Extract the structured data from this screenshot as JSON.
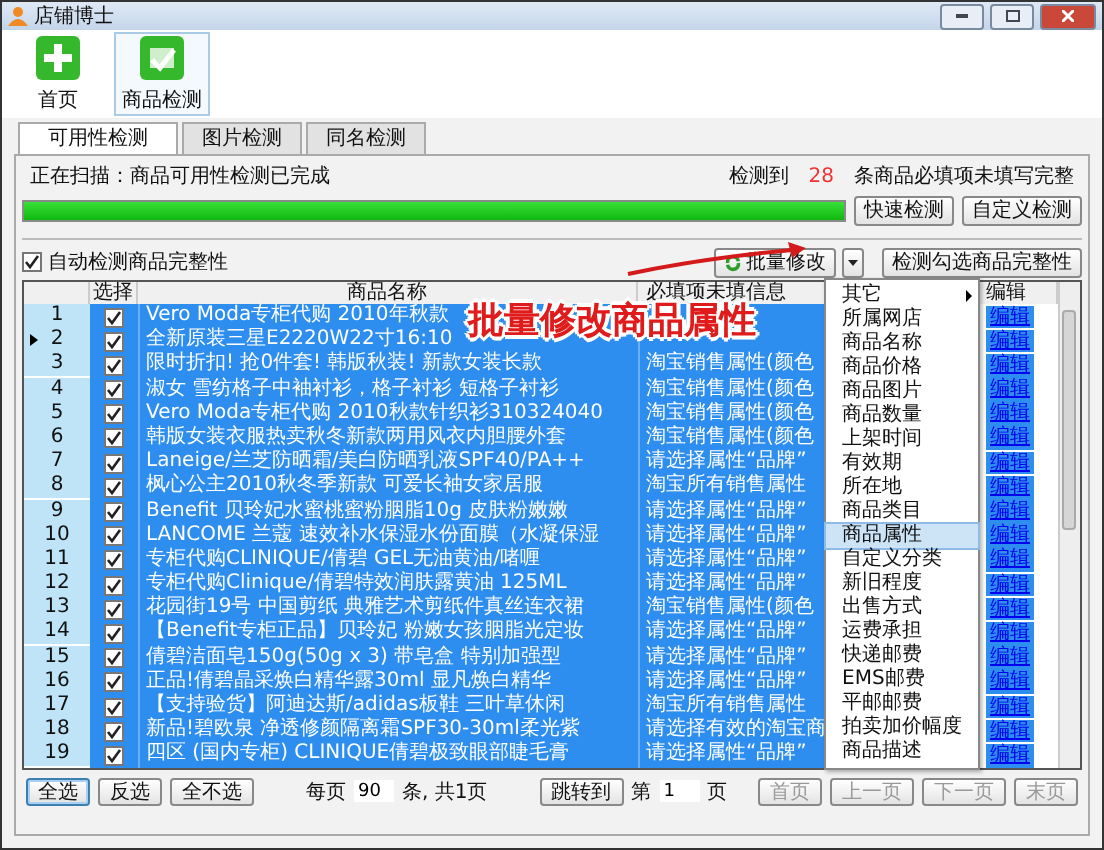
{
  "window": {
    "title": "店铺博士"
  },
  "toolbar": [
    {
      "label": "首页",
      "selected": false
    },
    {
      "label": "商品检测",
      "selected": true
    }
  ],
  "tabs": [
    {
      "label": "可用性检测",
      "selected": true
    },
    {
      "label": "图片检测",
      "selected": false
    },
    {
      "label": "同名检测",
      "selected": false
    }
  ],
  "scan_status": "正在扫描：商品可用性检测已完成",
  "summary": {
    "prefix": "检测到",
    "count": "28",
    "suffix": "条商品必填项未填写完整"
  },
  "progress": {
    "level": 1
  },
  "check_buttons": [
    "快速检测",
    "自定义检测"
  ],
  "auto_check": {
    "label": "自动检测商品完整性",
    "checked": true
  },
  "batch_button": "批量修改",
  "check_selected_button": "检测勾选商品完整性",
  "annotation": "批量修改商品属性",
  "table": {
    "columns": [
      "选择",
      "商品名称",
      "必填项未填信息",
      "编辑"
    ],
    "rows": [
      {
        "no": "1",
        "current": false,
        "checked": true,
        "selected": true,
        "name": "Vero Moda专柜代购 2010年秋款",
        "edit": "编辑"
      },
      {
        "no": "2",
        "current": true,
        "checked": true,
        "selected": true,
        "name": "全新原装三星E2220W22寸16:10",
        "edit": "编辑"
      },
      {
        "no": "3",
        "current": false,
        "checked": true,
        "selected": true,
        "name": "限时折扣! 抢0件套! 韩版秋装! 新款女装长款",
        "info": "淘宝销售属性(颜色",
        "edit": "编辑"
      },
      {
        "no": "4",
        "current": false,
        "checked": true,
        "selected": true,
        "name": "淑女 雪纺格子中袖衬衫，格子衬衫 短格子衬衫",
        "info": "淘宝销售属性(颜色",
        "edit": "编辑"
      },
      {
        "no": "5",
        "current": false,
        "checked": true,
        "selected": true,
        "name": "Vero Moda专柜代购 2010秋款针织衫310324040",
        "info": "淘宝销售属性(颜色",
        "edit": "编辑"
      },
      {
        "no": "6",
        "current": false,
        "checked": true,
        "selected": true,
        "name": "韩版女装衣服热卖秋冬新款两用风衣内胆腰外套",
        "info": "淘宝销售属性(颜色",
        "edit": "编辑"
      },
      {
        "no": "7",
        "current": false,
        "checked": true,
        "selected": true,
        "name": "Laneige/兰芝防晒霜/美白防晒乳液SPF40/PA++",
        "info": "请选择属性“品牌”",
        "edit": "编辑"
      },
      {
        "no": "8",
        "current": false,
        "checked": true,
        "selected": true,
        "name": "枫心公主2010秋冬季新款 可爱长袖女家居服",
        "info": "淘宝所有销售属性",
        "edit": "编辑"
      },
      {
        "no": "9",
        "current": false,
        "checked": true,
        "selected": true,
        "name": "Benefit 贝玲妃水蜜桃蜜粉胭脂10g 皮肤粉嫩嫩",
        "info": "请选择属性“品牌”",
        "edit": "编辑"
      },
      {
        "no": "10",
        "current": false,
        "checked": true,
        "selected": true,
        "name": "LANCOME 兰蔻 速效补水保湿水份面膜（水凝保湿",
        "info": "请选择属性“品牌”",
        "edit": "编辑"
      },
      {
        "no": "11",
        "current": false,
        "checked": true,
        "selected": true,
        "name": "专柜代购CLINIQUE/倩碧 GEL无油黄油/啫喱",
        "info": "请选择属性“品牌”",
        "edit": "编辑"
      },
      {
        "no": "12",
        "current": false,
        "checked": true,
        "selected": true,
        "name": "专柜代购Clinique/倩碧特效润肤露黄油 125ML",
        "info": "请选择属性“品牌”",
        "edit": "编辑"
      },
      {
        "no": "13",
        "current": false,
        "checked": true,
        "selected": true,
        "name": "花园街19号 中国剪纸 典雅艺术剪纸件真丝连衣裙",
        "info": "淘宝销售属性(颜色",
        "edit": "编辑"
      },
      {
        "no": "14",
        "current": false,
        "checked": true,
        "selected": true,
        "name": "【Benefit专柜正品】贝玲妃 粉嫩女孩胭脂光定妆",
        "info": "请选择属性“品牌”",
        "edit": "编辑"
      },
      {
        "no": "15",
        "current": false,
        "checked": true,
        "selected": true,
        "name": "倩碧洁面皂150g(50g x 3) 带皂盒 特别加强型",
        "info": "请选择属性“品牌”",
        "edit": "编辑"
      },
      {
        "no": "16",
        "current": false,
        "checked": true,
        "selected": true,
        "name": "正品!倩碧晶采焕白精华露30ml 显凡焕白精华",
        "info": "请选择属性“品牌”",
        "edit": "编辑"
      },
      {
        "no": "17",
        "current": false,
        "checked": true,
        "selected": true,
        "name": "【支持验货】阿迪达斯/adidas板鞋 三叶草休闲",
        "info": "淘宝所有销售属性",
        "edit": "编辑"
      },
      {
        "no": "18",
        "current": false,
        "checked": true,
        "selected": true,
        "name": "新品!碧欧泉 净透修颜隔离霜SPF30-30ml柔光紫",
        "info": "请选择有效的淘宝商",
        "edit": "编辑"
      },
      {
        "no": "19",
        "current": false,
        "checked": true,
        "selected": true,
        "name": "四区 (国内专柜) CLINIQUE倩碧极致眼部睫毛膏",
        "info": "请选择属性“品牌”",
        "edit": "编辑"
      }
    ]
  },
  "menu": [
    {
      "label": "其它",
      "submenu": true,
      "selected": false
    },
    {
      "label": "所属网店",
      "submenu": false,
      "selected": false
    },
    {
      "label": "商品名称",
      "submenu": false,
      "selected": false
    },
    {
      "label": "商品价格",
      "submenu": false,
      "selected": false
    },
    {
      "label": "商品图片",
      "submenu": false,
      "selected": false
    },
    {
      "label": "商品数量",
      "submenu": false,
      "selected": false
    },
    {
      "label": "上架时间",
      "submenu": false,
      "selected": false
    },
    {
      "label": "有效期",
      "submenu": false,
      "selected": false
    },
    {
      "label": "所在地",
      "submenu": false,
      "selected": false
    },
    {
      "label": "商品类目",
      "submenu": false,
      "selected": false
    },
    {
      "label": "商品属性",
      "submenu": false,
      "selected": true
    },
    {
      "label": "自定义分类",
      "submenu": false,
      "selected": false
    },
    {
      "label": "新旧程度",
      "submenu": false,
      "selected": false
    },
    {
      "label": "出售方式",
      "submenu": false,
      "selected": false
    },
    {
      "label": "运费承担",
      "submenu": false,
      "selected": false
    },
    {
      "label": "快递邮费",
      "submenu": false,
      "selected": false
    },
    {
      "label": "EMS邮费",
      "submenu": false,
      "selected": false
    },
    {
      "label": "平邮邮费",
      "submenu": false,
      "selected": false
    },
    {
      "label": "拍卖加价幅度",
      "submenu": false,
      "selected": false
    },
    {
      "label": "商品描述",
      "submenu": false,
      "selected": false
    }
  ],
  "footer": {
    "select_buttons": [
      {
        "label": "全选",
        "focused": true
      },
      {
        "label": "反选",
        "focused": false
      },
      {
        "label": "全不选",
        "focused": false
      }
    ],
    "per_page_label": "每页",
    "per_page": "90",
    "pages_text": "条, 共1页",
    "jump_button": "跳转到",
    "page_prefix": "第",
    "page": "1",
    "page_suffix": "页",
    "nav_buttons": [
      {
        "label": "首页",
        "disabled": true
      },
      {
        "label": "上一页",
        "disabled": true
      },
      {
        "label": "下一页",
        "disabled": true
      },
      {
        "label": "末页",
        "disabled": true
      }
    ]
  }
}
